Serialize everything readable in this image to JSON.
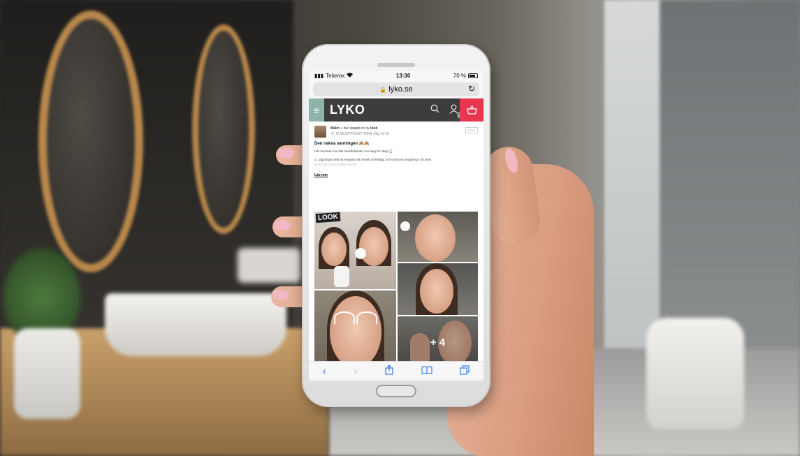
{
  "status_bar": {
    "carrier": "Telavox",
    "time": "13:30",
    "battery": "70 %"
  },
  "browser": {
    "url": "lyko.se"
  },
  "site": {
    "logo": "LYKO",
    "account_badge": "2"
  },
  "post": {
    "author": "Malin",
    "action": "har skapat en ny",
    "action_link": "look",
    "subtitle": "KUNDUPPSKATTNING",
    "date": "Maj 19:16",
    "follow_label": "FÖLJ",
    "title": "Den nakna sanningen",
    "intro": "Här kommer min lilla hudvårdsrutin i en steg för steg! 📋",
    "step1": "1. Jag börjar med att rengöra mitt smink ordentligt, och mascara rengöring i så 3min",
    "step1_cont": "innan jag sedan sköljer av den.",
    "read_more": "Läs mer",
    "look_tag": "LOOK",
    "more_photos": "+ 4"
  },
  "icons": {
    "wifi": "wifi-icon",
    "lock": "lock-icon",
    "reload": "reload-icon",
    "menu": "hamburger-menu-icon",
    "search": "search-icon",
    "account": "user-icon",
    "cart": "basket-icon",
    "back": "chevron-left-icon",
    "forward": "chevron-right-icon",
    "share": "share-icon",
    "bookmarks": "book-icon",
    "tabs": "tabs-icon"
  },
  "colors": {
    "header_bg": "#3d3d3d",
    "menu_accent": "#8fb2ab",
    "cart_accent": "#e8364e",
    "ios_blue": "#2f7ae5"
  }
}
